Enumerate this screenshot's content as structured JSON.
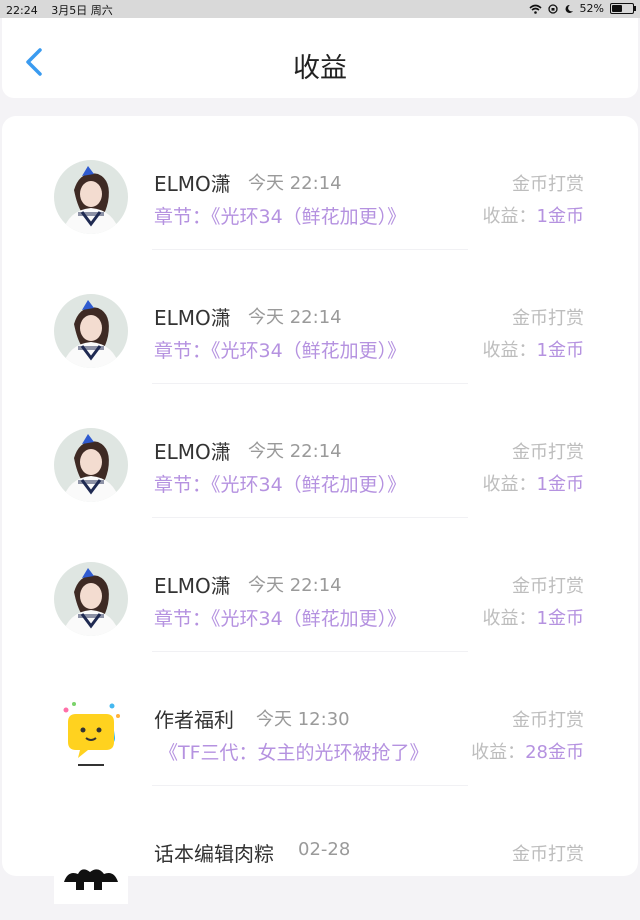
{
  "status_bar": {
    "time": "22:24",
    "date": "3月5日 周六",
    "battery": "52%",
    "battery_level": 0.52
  },
  "header": {
    "title": "收益"
  },
  "items": [
    {
      "name": "ELMO潇",
      "time": "今天 22:14",
      "chapter": "章节：《光环34（鲜花加更）》",
      "type": "金币打赏",
      "earn_label": "收益：",
      "earn_value": "1金币"
    },
    {
      "name": "ELMO潇",
      "time": "今天 22:14",
      "chapter": "章节：《光环34（鲜花加更）》",
      "type": "金币打赏",
      "earn_label": "收益：",
      "earn_value": "1金币"
    },
    {
      "name": "ELMO潇",
      "time": "今天 22:14",
      "chapter": "章节：《光环34（鲜花加更）》",
      "type": "金币打赏",
      "earn_label": "收益：",
      "earn_value": "1金币"
    },
    {
      "name": "ELMO潇",
      "time": "今天 22:14",
      "chapter": "章节：《光环34（鲜花加更）》",
      "type": "金币打赏",
      "earn_label": "收益：",
      "earn_value": "1金币"
    },
    {
      "name": "作者福利",
      "time": "今天 12:30",
      "chapter": "《TF三代：女主的光环被抢了》",
      "type": "金币打赏",
      "earn_label": "收益：",
      "earn_value": "28金币"
    },
    {
      "name": "话本编辑肉粽",
      "time": "02-28",
      "chapter": "",
      "type": "金币打赏",
      "earn_label": "",
      "earn_value": ""
    }
  ],
  "colors": {
    "accent": "#b592e0",
    "back_arrow": "#3a9bf0"
  }
}
